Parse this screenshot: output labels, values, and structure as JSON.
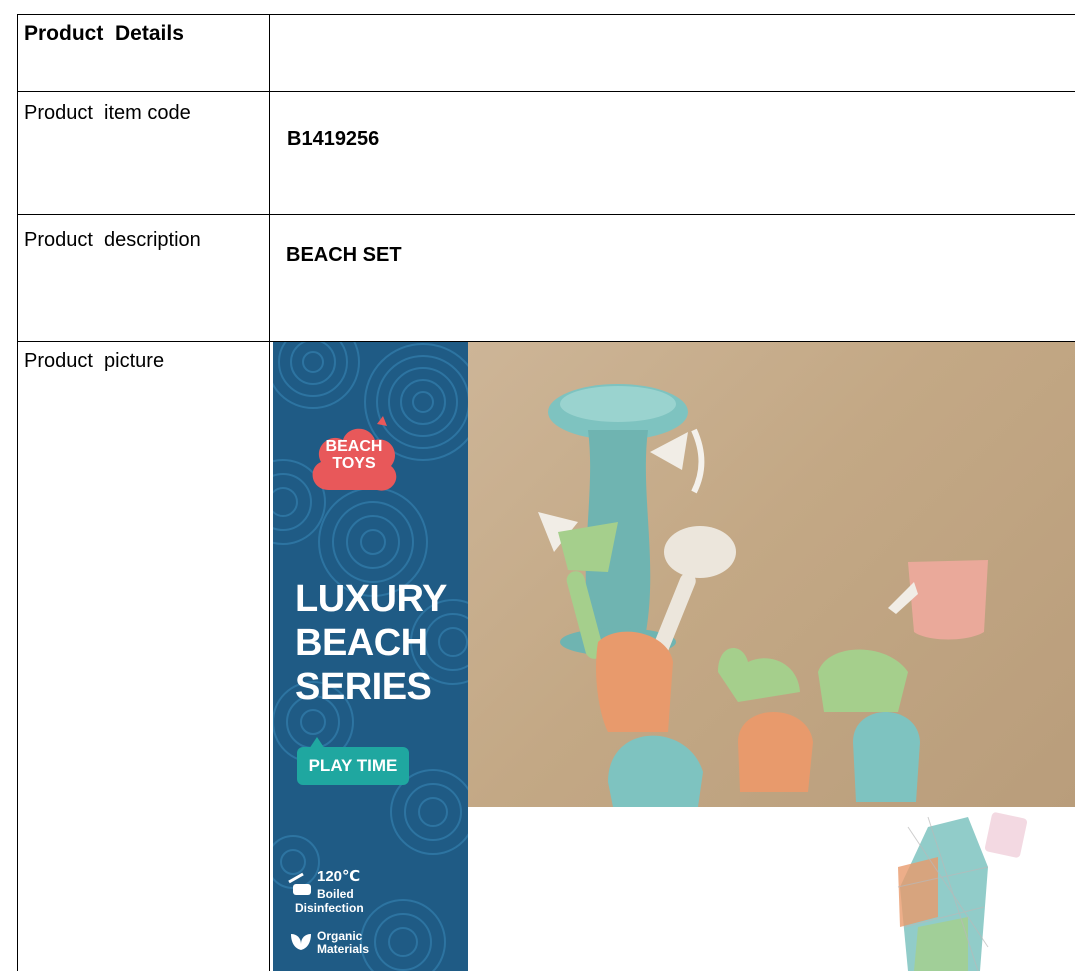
{
  "table": {
    "header": {
      "label": "Product  Details",
      "value": ""
    },
    "rows": [
      {
        "label": "Product  item code",
        "value": "B1419256"
      },
      {
        "label": "Product  description",
        "value": "BEACH SET"
      },
      {
        "label": "Product  picture",
        "value": ""
      }
    ]
  },
  "picture": {
    "logo": {
      "line1": "BEACH",
      "line2": "TOYS"
    },
    "series": {
      "line1": "LUXURY",
      "line2": "BEACH",
      "line3": "SERIES"
    },
    "badge": "PLAY TIME",
    "features": {
      "temperature": "120℃",
      "boiled": "Boiled",
      "disinfection": "Disinfection",
      "organic": "Organic",
      "materials": "Materials"
    },
    "colors": {
      "banner": "#1f5b85",
      "logo_cloud": "#e8585a",
      "badge": "#1fa7a0",
      "mill": "#7ec3c0",
      "green_mold": "#a5cf8c",
      "orange_mold": "#e89a6c",
      "pink_can": "#eaa99a",
      "cream_spade": "#ece6dc"
    }
  }
}
